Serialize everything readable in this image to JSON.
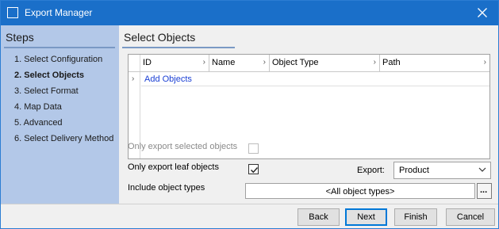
{
  "window": {
    "title": "Export Manager"
  },
  "steps": {
    "title": "Steps",
    "items": [
      {
        "label": "1. Select Configuration",
        "active": false
      },
      {
        "label": "2. Select Objects",
        "active": true
      },
      {
        "label": "3. Select Format",
        "active": false
      },
      {
        "label": "4. Map Data",
        "active": false
      },
      {
        "label": "5. Advanced",
        "active": false
      },
      {
        "label": "6. Select Delivery Method",
        "active": false
      }
    ]
  },
  "main": {
    "title": "Select Objects",
    "grid": {
      "columns": [
        "ID",
        "Name",
        "Object Type",
        "Path"
      ],
      "add_link": "Add Objects"
    },
    "options": {
      "only_selected_label": "Only export selected objects",
      "only_selected_checked": false,
      "only_selected_enabled": false,
      "only_leaf_label": "Only export leaf objects",
      "only_leaf_checked": true,
      "export_label": "Export:",
      "export_value": "Product",
      "include_types_label": "Include object types",
      "include_types_value": "<All object types>",
      "browse_label": "..."
    }
  },
  "footer": {
    "back": "Back",
    "next": "Next",
    "finish": "Finish",
    "cancel": "Cancel"
  },
  "colors": {
    "titlebar": "#1a6fc9",
    "steps_panel": "#b3c8e8",
    "link": "#1a3fd4",
    "primary_border": "#0078d7"
  }
}
